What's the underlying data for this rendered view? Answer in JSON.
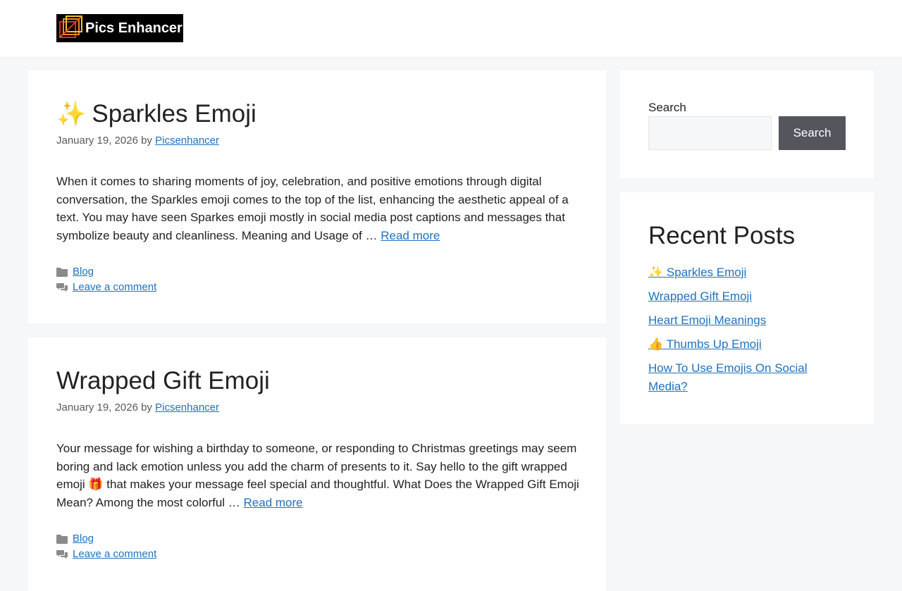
{
  "site": {
    "name": "Pics Enhancer"
  },
  "posts": [
    {
      "emoji": "✨",
      "title": "Sparkles Emoji",
      "date": "January 19, 2026",
      "by": "by",
      "author": "Picsenhancer",
      "excerpt": "When it comes to sharing moments of joy, celebration, and positive emotions through digital conversation, the Sparkles emoji comes to the top of the list, enhancing the aesthetic appeal of a text. You may have seen Sparkes emoji mostly in social media post captions and messages that symbolize beauty and cleanliness. Meaning and Usage of … ",
      "read_more": "Read more",
      "category": "Blog",
      "comment_link": "Leave a comment"
    },
    {
      "emoji": "",
      "title": "Wrapped Gift Emoji",
      "date": "January 19, 2026",
      "by": "by",
      "author": "Picsenhancer",
      "excerpt": "Your message for wishing a birthday to someone, or responding to Christmas greetings may seem boring and lack emotion unless you add the charm of presents to it. Say hello to the gift wrapped emoji 🎁 that makes your message feel special and thoughtful. What Does the Wrapped Gift Emoji Mean? Among the most colorful … ",
      "read_more": "Read more",
      "category": "Blog",
      "comment_link": "Leave a comment"
    }
  ],
  "sidebar": {
    "search": {
      "label": "Search",
      "placeholder": "",
      "value": "",
      "button_label": "Search"
    },
    "recent": {
      "title": "Recent Posts",
      "items": [
        "✨ Sparkles Emoji",
        "Wrapped Gift Emoji",
        "Heart Emoji Meanings",
        "👍 Thumbs Up Emoji",
        "How To Use Emojis On Social Media?"
      ]
    }
  },
  "colors": {
    "link": "#1e72bd",
    "background": "#f6f7f8",
    "button": "#55555e"
  },
  "icons": {
    "category": "folder-icon",
    "comments": "comments-icon"
  }
}
